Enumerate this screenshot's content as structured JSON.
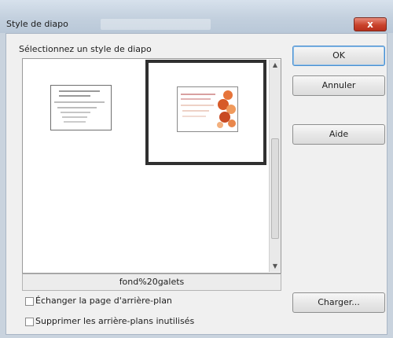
{
  "window": {
    "title": "Style de diapo",
    "close_label": "x"
  },
  "select_label": "Sélectionnez un style de diapo",
  "styles": [
    {
      "kind": "plain"
    },
    {
      "kind": "galets",
      "selected": true
    }
  ],
  "selected_name": "fond%20galets",
  "checkboxes": [
    {
      "label": "Échanger la page d'arrière-plan",
      "checked": false
    },
    {
      "label": "Supprimer les arrière-plans inutilisés",
      "checked": false
    }
  ],
  "buttons": {
    "ok": "OK",
    "cancel": "Annuler",
    "help": "Aide",
    "load": "Charger..."
  },
  "colors": {
    "accent": "#4a8fd0",
    "close": "#c9432c"
  }
}
